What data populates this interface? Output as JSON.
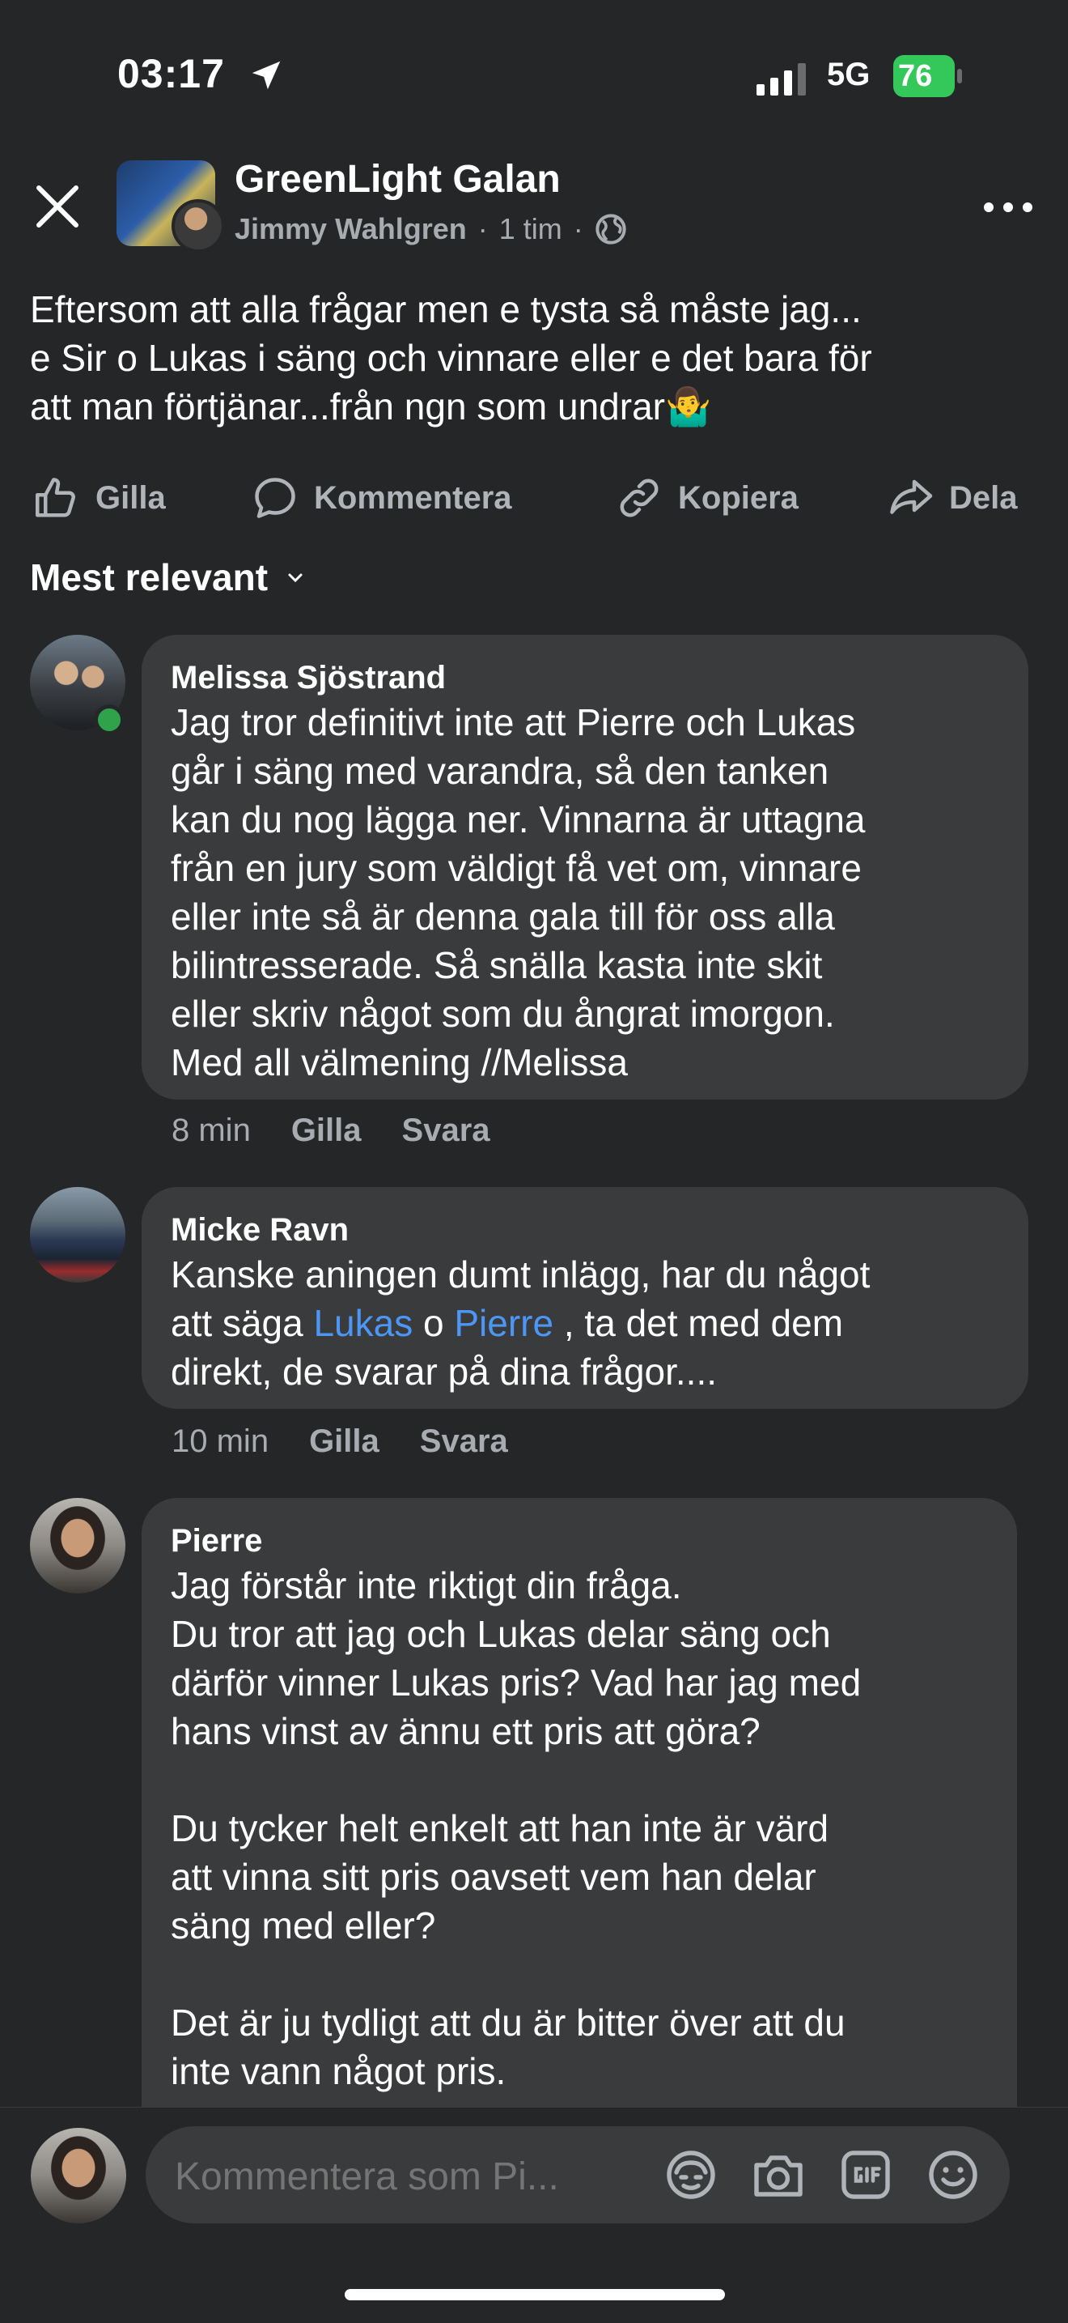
{
  "status_bar": {
    "time": "03:17",
    "network": "5G",
    "battery": "76"
  },
  "header": {
    "group_name": "GreenLight Galan",
    "author": "Jimmy Wahlgren",
    "separator": "·",
    "time": "1 tim"
  },
  "post": {
    "text": "Eftersom att alla frågar men e tysta så måste jag...\ne Sir o Lukas i säng och vinnare eller e det bara för\natt man förtjänar...från ngn som undrar🤷‍♂️"
  },
  "actions": {
    "like": "Gilla",
    "comment": "Kommentera",
    "copy": "Kopiera",
    "share": "Dela"
  },
  "sort": {
    "label": "Mest relevant"
  },
  "comments": [
    {
      "author": "Melissa Sjöstrand",
      "text": "Jag tror definitivt inte att Pierre och Lukas\ngår i säng med varandra, så den tanken\nkan du nog lägga ner. Vinnarna är uttagna\nfrån en jury som väldigt få vet om, vinnare\neller inte så är denna gala till för oss alla\nbilintresserade. Så snälla kasta inte skit\neller skriv något som du ångrat imorgon.\nMed all välmening //Melissa",
      "time": "8 min",
      "like": "Gilla",
      "reply": "Svara"
    },
    {
      "author": "Micke Ravn",
      "text_before": "Kanske aningen dumt inlägg, har du något\natt säga ",
      "mention_1": "Lukas",
      "text_mid": " o ",
      "mention_2": "Pierre",
      "text_after": " , ta det med dem\ndirekt, de svarar på dina frågor....",
      "time": "10 min",
      "like": "Gilla",
      "reply": "Svara"
    },
    {
      "author": "Pierre",
      "text": "Jag förstår inte riktigt din fråga.\nDu tror att jag och Lukas delar säng och\ndärför vinner Lukas pris? Vad har jag med\nhans vinst av ännu ett pris att göra?\n\nDu tycker helt enkelt att han inte är värd\natt vinna sitt pris oavsett vem han delar\nsäng med eller?\n\nDet är ju tydligt att du är bitter över att du\ninte vann något pris."
    }
  ],
  "composer": {
    "placeholder": "Kommentera som Pi..."
  },
  "colors": {
    "background": "#252628",
    "bubble": "#3a3b3c",
    "mention": "#4c97f5",
    "online": "#31a24c",
    "battery": "#34c759"
  }
}
